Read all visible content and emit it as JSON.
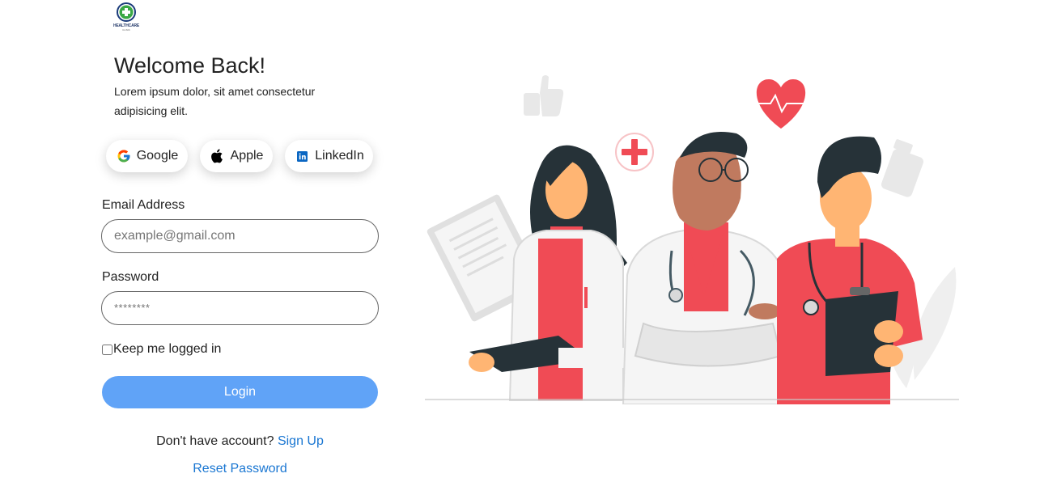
{
  "brand": {
    "logo_text": "HEALTHCARE",
    "logo_subtext": "CLINIC"
  },
  "header": {
    "title": "Welcome Back!",
    "subtitle": "Lorem ipsum dolor, sit amet consectetur adipisicing elit."
  },
  "social": {
    "google_label": "Google",
    "apple_label": "Apple",
    "linkedin_label": "LinkedIn"
  },
  "form": {
    "email_label": "Email Address",
    "email_placeholder": "example@gmail.com",
    "password_label": "Password",
    "password_placeholder": "********",
    "keep_logged_label": "Keep me logged in",
    "login_label": "Login",
    "signup_prompt": "Don't have account?",
    "signup_link": "Sign Up",
    "reset_link": "Reset Password"
  },
  "icons": {
    "logo": "medical-cross-logo-icon",
    "google": "google-icon",
    "apple": "apple-icon",
    "linkedin": "linkedin-icon"
  },
  "colors": {
    "accent": "#60a3f7",
    "link": "#1976d2",
    "illustration_red": "#f04b55",
    "illustration_dark": "#263238"
  }
}
